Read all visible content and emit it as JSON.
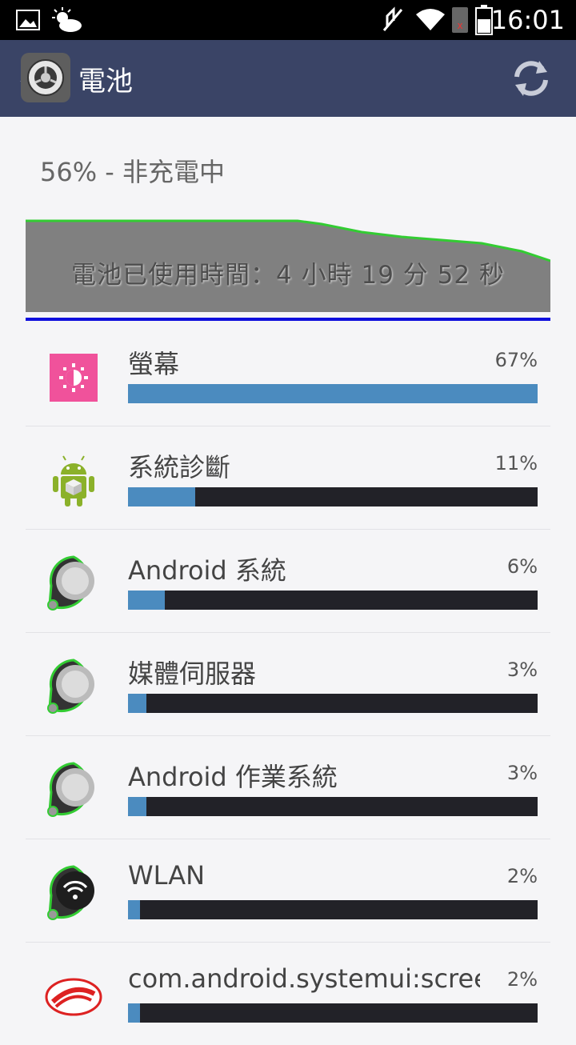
{
  "status_bar": {
    "time": "16:01"
  },
  "action_bar": {
    "back": "〈",
    "title": "電池",
    "app_icon": "settings-gear-icon",
    "refresh_icon": "refresh-icon"
  },
  "battery": {
    "status": "56% - 非充電中",
    "usage_label": "電池已使用時間：4 小時 19 分 52 秒",
    "graph_fill_color": "#808080",
    "graph_line_color": "#33cc33"
  },
  "items": [
    {
      "label": "螢幕",
      "percent": "67%",
      "value": 67,
      "icon": "brightness-icon"
    },
    {
      "label": "系統診斷",
      "percent": "11%",
      "value": 11,
      "icon": "android-robot-icon"
    },
    {
      "label": "Android 系統",
      "percent": "6%",
      "value": 6,
      "icon": "system-pin-icon"
    },
    {
      "label": "媒體伺服器",
      "percent": "3%",
      "value": 3,
      "icon": "system-pin-icon"
    },
    {
      "label": "Android 作業系統",
      "percent": "3%",
      "value": 3,
      "icon": "system-pin-icon"
    },
    {
      "label": "WLAN",
      "percent": "2%",
      "value": 2,
      "icon": "wifi-pin-icon"
    },
    {
      "label": "com.android.systemui:scree",
      "percent": "2%",
      "value": 2,
      "icon": "android-logo-icon"
    }
  ]
}
